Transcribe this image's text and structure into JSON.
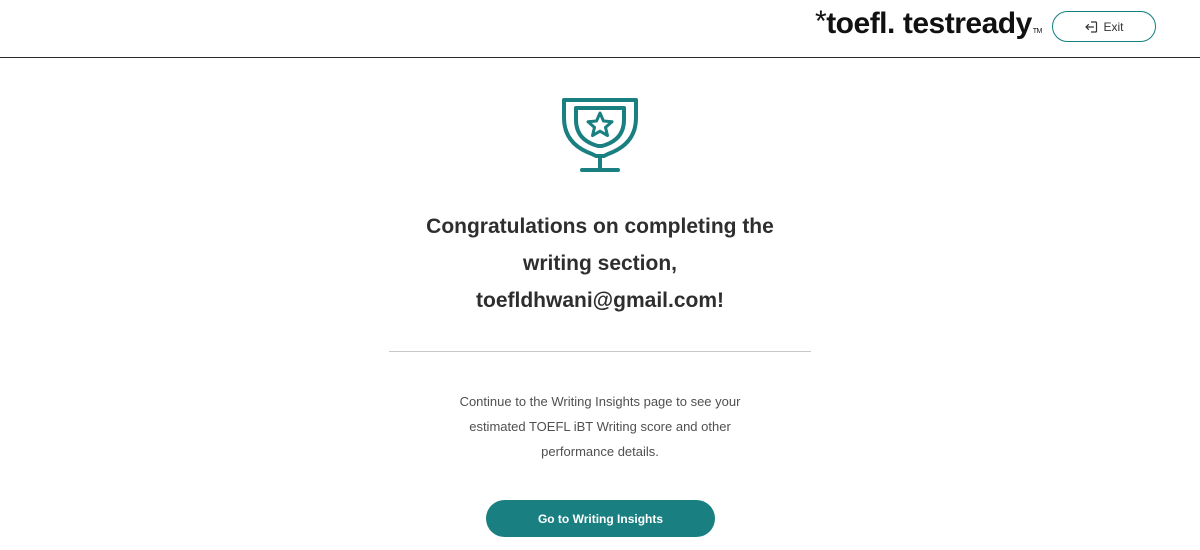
{
  "header": {
    "logo": {
      "star": "*",
      "brand_part1": "toefl",
      "dot": ".",
      "brand_part2": "testready",
      "trademark": "TM"
    },
    "exit_button": {
      "label": "Exit",
      "icon": "exit-icon"
    }
  },
  "main": {
    "trophy_icon": "trophy-star-icon",
    "headline_line1": "Congratulations on completing the",
    "headline_line2": "writing section,",
    "headline_line3": "toefldhwani@gmail.com!",
    "description_line1": "Continue to the Writing Insights page to see your",
    "description_line2": "estimated TOEFL iBT Writing score and other",
    "description_line3": "performance details.",
    "cta_label": "Go to Writing Insights"
  },
  "colors": {
    "accent": "#1a7f80",
    "divider": "#c9c9c9",
    "text": "#2e2e2e"
  }
}
